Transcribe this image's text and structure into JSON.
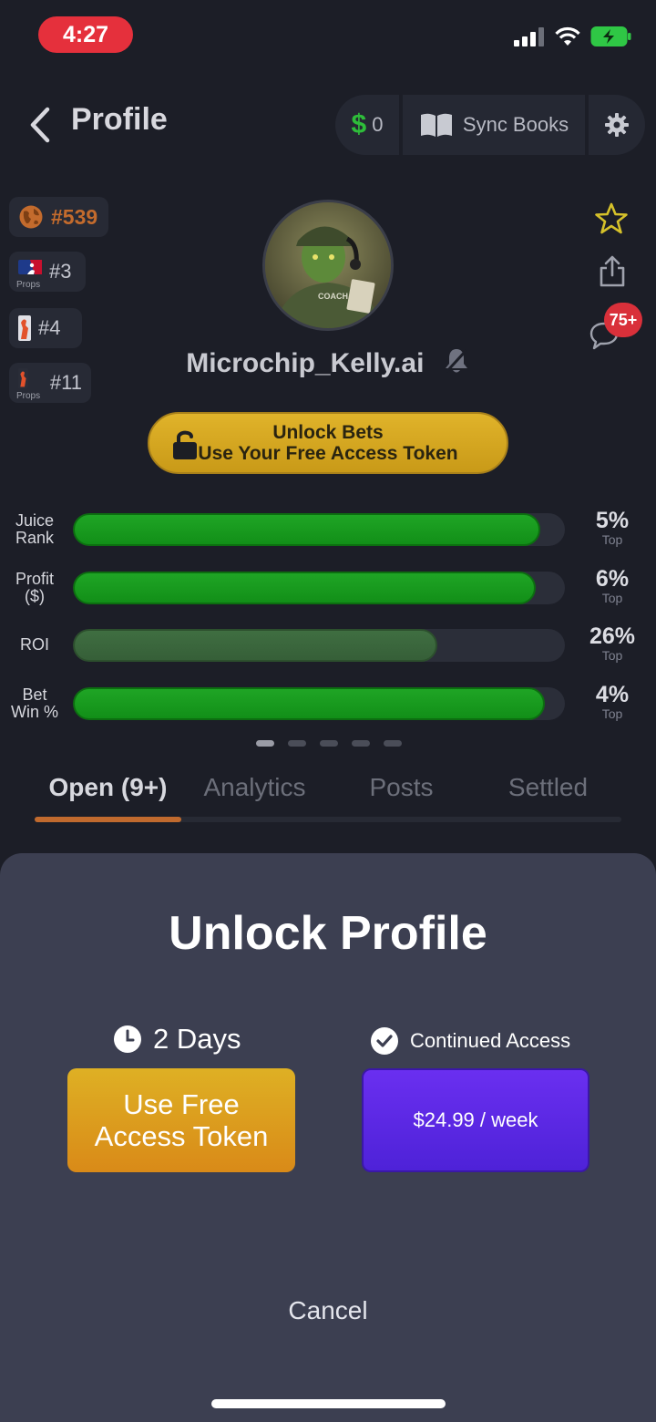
{
  "status": {
    "time": "4:27"
  },
  "header": {
    "back_icon": "chevron-left-icon",
    "title": "Profile",
    "balance": "0",
    "sync_label": "Sync Books"
  },
  "ranks": [
    {
      "label": "#539",
      "icon": "globe-icon",
      "sub": ""
    },
    {
      "label": "#3",
      "icon": "mlb-icon",
      "sub": "Props"
    },
    {
      "label": "#4",
      "icon": "wnba-icon",
      "sub": ""
    },
    {
      "label": "#11",
      "icon": "wnba-icon",
      "sub": "Props"
    }
  ],
  "profile": {
    "username": "Microchip_Kelly.ai",
    "avatar_text": "COACH",
    "chat_badge": "75+"
  },
  "unlock": {
    "line1": "Unlock Bets",
    "line2": "Use Your Free Access Token"
  },
  "stats": [
    {
      "label1": "Juice",
      "label2": "Rank",
      "value": "5%",
      "sub": "Top",
      "fill": 0.95
    },
    {
      "label1": "Profit",
      "label2": "($)",
      "value": "6%",
      "sub": "Top",
      "fill": 0.94
    },
    {
      "label1": "ROI",
      "label2": "",
      "value": "26%",
      "sub": "Top",
      "fill": 0.74
    },
    {
      "label1": "Bet",
      "label2": "Win %",
      "value": "4%",
      "sub": "Top",
      "fill": 0.96
    }
  ],
  "tabs": [
    "Open (9+)",
    "Analytics",
    "Posts",
    "Settled"
  ],
  "sheet": {
    "title": "Unlock Profile",
    "option1_head": "2 Days",
    "option1_btn_line1": "Use Free",
    "option1_btn_line2": "Access Token",
    "option2_head": "Continued Access",
    "option2_btn": "$24.99 / week",
    "cancel": "Cancel"
  },
  "colors": {
    "accent_orange": "#c06a2e",
    "gold": "#deb024",
    "purple": "#5a28e4",
    "bar_green": "#1fa525",
    "badge_red": "#d9303a"
  }
}
